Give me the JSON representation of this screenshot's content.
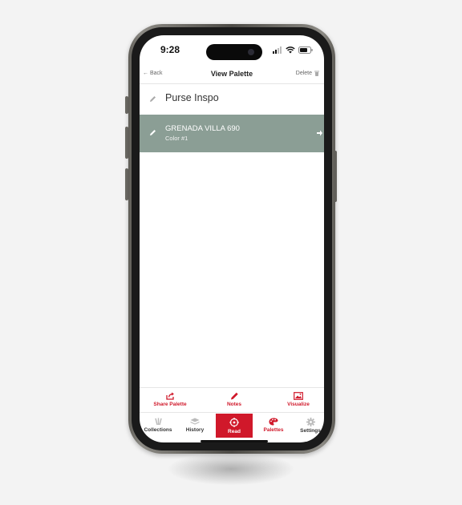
{
  "status_bar": {
    "time": "9:28"
  },
  "header": {
    "back_label": "Back",
    "title": "View Palette",
    "delete_label": "Delete"
  },
  "palette": {
    "name": "Purse Inspo"
  },
  "colors": [
    {
      "name": "GRENADA VILLA 690",
      "subtitle": "Color #1",
      "swatch": "#8b9e95"
    }
  ],
  "actions": [
    {
      "label": "Share Palette",
      "icon": "share-icon"
    },
    {
      "label": "Notes",
      "icon": "pencil-icon"
    },
    {
      "label": "Visualize",
      "icon": "image-icon"
    }
  ],
  "tabs": [
    {
      "label": "Collections",
      "icon": "collections-icon"
    },
    {
      "label": "History",
      "icon": "layers-icon"
    },
    {
      "label": "Read",
      "icon": "target-icon"
    },
    {
      "label": "Palettes",
      "icon": "palette-icon"
    },
    {
      "label": "Settings",
      "icon": "gear-icon"
    }
  ],
  "active_tab": "Palettes",
  "accent_color": "#d0182a"
}
